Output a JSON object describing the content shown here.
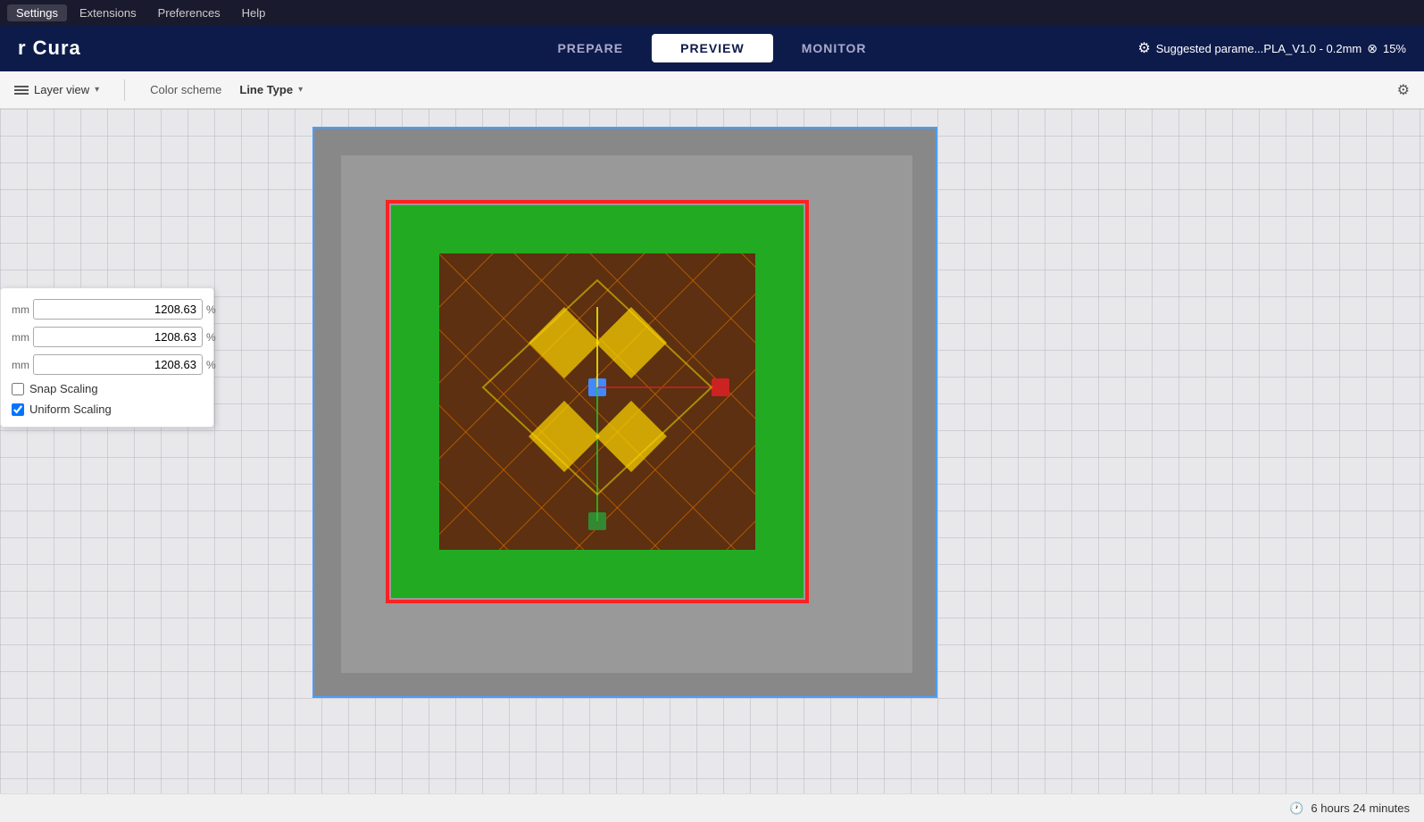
{
  "app": {
    "title": "r Cura"
  },
  "menubar": {
    "items": [
      "Settings",
      "Extensions",
      "Preferences",
      "Help"
    ]
  },
  "nav": {
    "tabs": [
      "PREPARE",
      "PREVIEW",
      "MONITOR"
    ],
    "active_tab": "PREVIEW"
  },
  "toolbar": {
    "view_label": "Layer view",
    "color_scheme_label": "Color scheme",
    "color_scheme_value": "Line Type",
    "chevron": "▾"
  },
  "suggested_params": {
    "label": "Suggested parame...PLA_V1.0 - 0.2mm",
    "percentage": "15%"
  },
  "dimensions": {
    "x_label": "mm",
    "y_label": "mm",
    "z_label": "mm",
    "x_value": "1208.63",
    "y_value": "1208.63",
    "z_value": "1208.63",
    "percent": "%"
  },
  "checkboxes": {
    "snap_scaling": {
      "label": "Snap Scaling",
      "checked": false
    },
    "uniform_scaling": {
      "label": "Uniform Scaling",
      "checked": true
    }
  },
  "statusbar": {
    "time_icon": "🕐",
    "time_label": "6 hours 24 minutes"
  },
  "colors": {
    "outer_wall": "#ff4444",
    "inner_wall": "#ff8800",
    "infill": "#8b4513",
    "skin": "#ffd700",
    "support": "#22aa22",
    "travel": "#44aaff",
    "accent": "#4a9eff",
    "bg": "#888888"
  }
}
